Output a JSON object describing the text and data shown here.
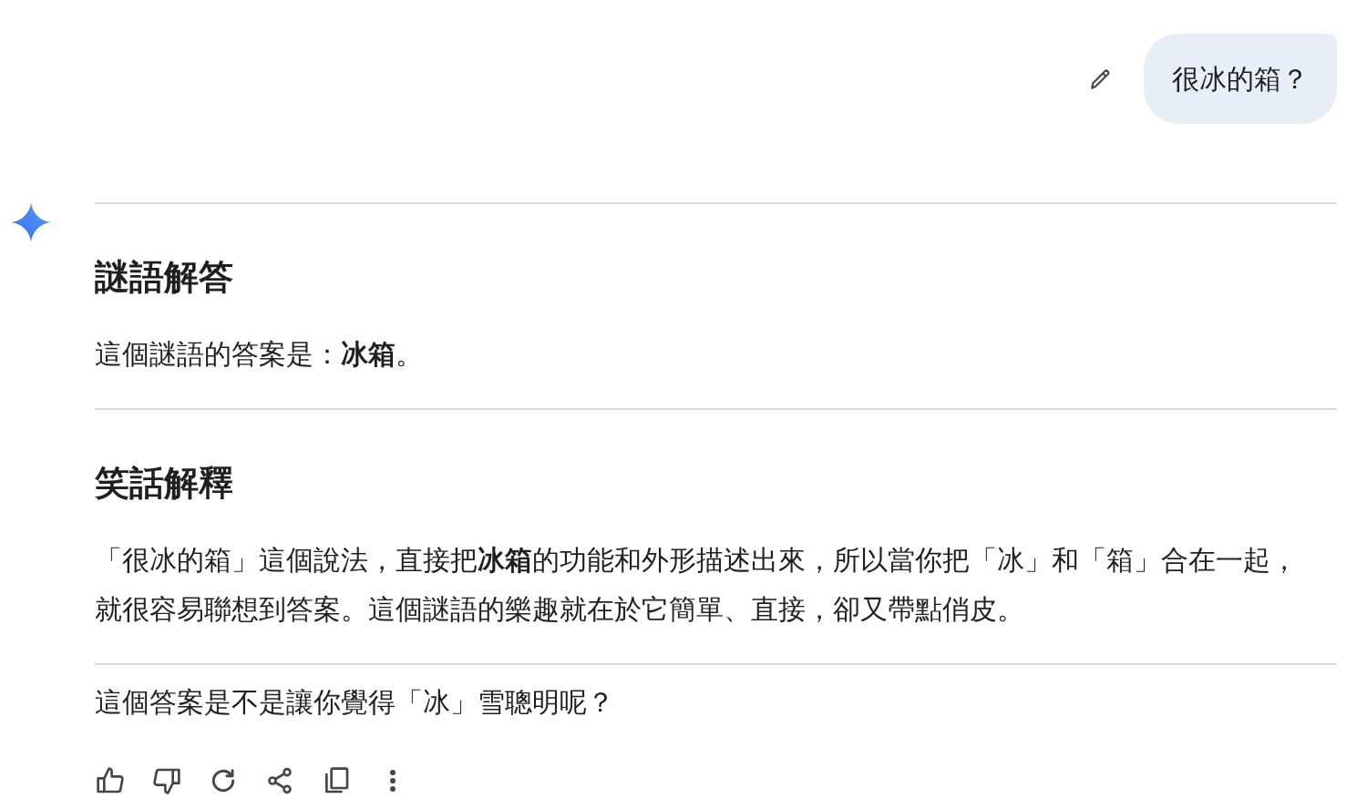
{
  "user_message": {
    "text": "很冰的箱？"
  },
  "response": {
    "blocks": [
      {
        "kind": "rule"
      },
      {
        "kind": "heading",
        "text": "謎語解答"
      },
      {
        "kind": "paragraph",
        "text": "這個謎語的答案是：**冰箱**。"
      },
      {
        "kind": "rule"
      },
      {
        "kind": "heading",
        "text": "笑話解釋"
      },
      {
        "kind": "paragraph",
        "text": "「很冰的箱」這個說法，直接把**冰箱**的功能和外形描述出來，所以當你把「冰」和「箱」合在一起，就很容易聯想到答案。這個謎語的樂趣就在於它簡單、直接，卻又帶點俏皮。"
      },
      {
        "kind": "rule"
      },
      {
        "kind": "paragraph",
        "text": "這個答案是不是讓你覺得「冰」雪聰明呢？"
      }
    ]
  }
}
